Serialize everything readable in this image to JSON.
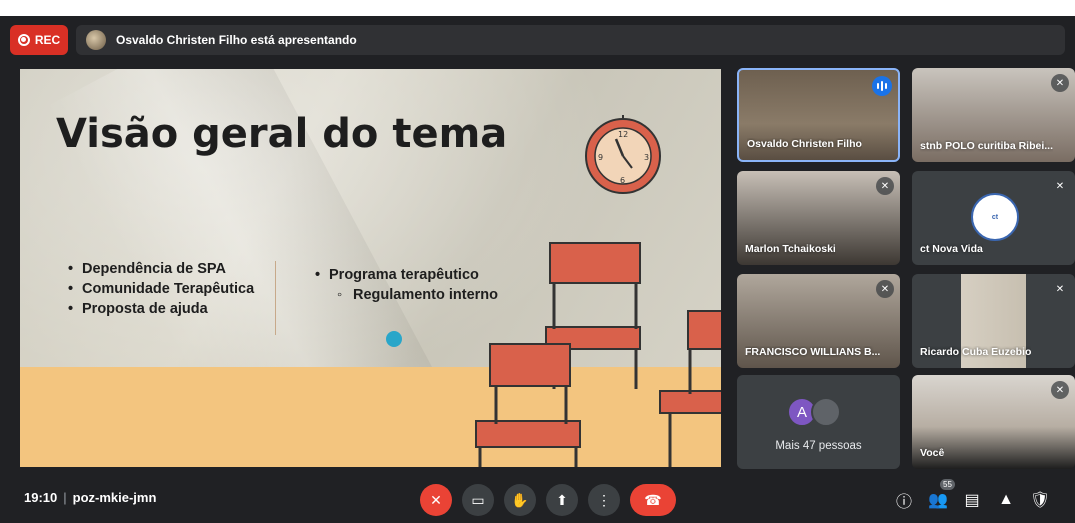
{
  "recording": {
    "label": "REC"
  },
  "presenting_banner": {
    "text": "Osvaldo Christen Filho está apresentando"
  },
  "slide": {
    "title": "Visão geral do tema",
    "left_bullets": [
      "Dependência de SPA",
      "Comunidade Terapêutica",
      "Proposta de ajuda"
    ],
    "right_bullets": [
      "Programa terapêutico"
    ],
    "right_sub_bullets": [
      "Regulamento interno"
    ]
  },
  "participants": [
    {
      "name": "Osvaldo Christen Filho",
      "speaking": true,
      "muted": false
    },
    {
      "name": "stnb POLO curitiba Ribei...",
      "speaking": false,
      "muted": true
    },
    {
      "name": "Marlon Tchaikoski",
      "speaking": false,
      "muted": true
    },
    {
      "name": "ct Nova Vida",
      "speaking": false,
      "muted": true
    },
    {
      "name": "FRANCISCO WILLIANS B...",
      "speaking": false,
      "muted": true
    },
    {
      "name": "Ricardo Cuba Euzebio",
      "speaking": false,
      "muted": true
    },
    {
      "name": "Você",
      "speaking": false,
      "muted": true
    }
  ],
  "more_people": {
    "initial": "A",
    "label": "Mais 47 pessoas"
  },
  "bottom": {
    "time": "19:10",
    "meeting_code": "poz-mkie-jmn",
    "participant_count": "55",
    "icons": [
      "mic-off-icon",
      "camera-icon",
      "raise-hand-icon",
      "present-icon",
      "more-options-icon",
      "hang-up-icon",
      "info-icon",
      "people-icon",
      "chat-icon",
      "activities-icon",
      "security-icon"
    ]
  },
  "colors": {
    "rec": "#d93025",
    "hangup": "#ea4335",
    "active_border": "#8ab4f8",
    "speaking": "#1a73e8"
  }
}
